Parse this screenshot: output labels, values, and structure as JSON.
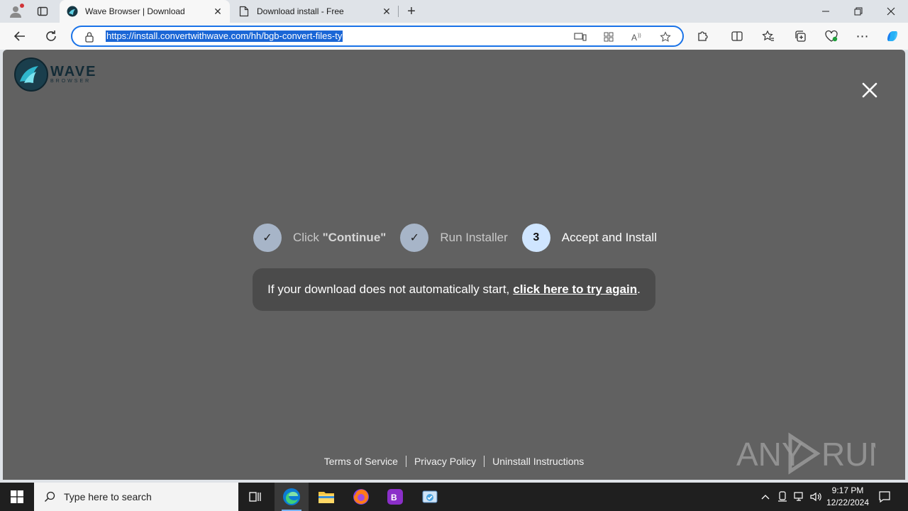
{
  "browser": {
    "tabs": [
      {
        "title": "Wave Browser | Download",
        "active": true
      },
      {
        "title": "Download install - Free",
        "active": false
      }
    ],
    "url": "https://install.convertwithwave.com/hh/bgb-convert-files-ty",
    "accent": "#1a73e8"
  },
  "page": {
    "logo": {
      "word": "WAVE",
      "sub": "BROWSER"
    },
    "steps": [
      {
        "prefix": "Click ",
        "label": "\"Continue\"",
        "marker": "✓",
        "state": "done"
      },
      {
        "prefix": "",
        "label": "Run Installer",
        "marker": "✓",
        "state": "done"
      },
      {
        "prefix": "",
        "label": "Accept and Install",
        "marker": "3",
        "state": "current"
      }
    ],
    "notice": {
      "text": "If your download does not automatically start,",
      "link": "click here to try again",
      "suffix": "."
    },
    "footer": {
      "terms": "Terms of Service",
      "privacy": "Privacy Policy",
      "uninstall": "Uninstall Instructions"
    },
    "watermark": "ANY RUN",
    "background": "#616161"
  },
  "taskbar": {
    "search_placeholder": "Type here to search",
    "time": "9:17 PM",
    "date": "12/22/2024"
  }
}
